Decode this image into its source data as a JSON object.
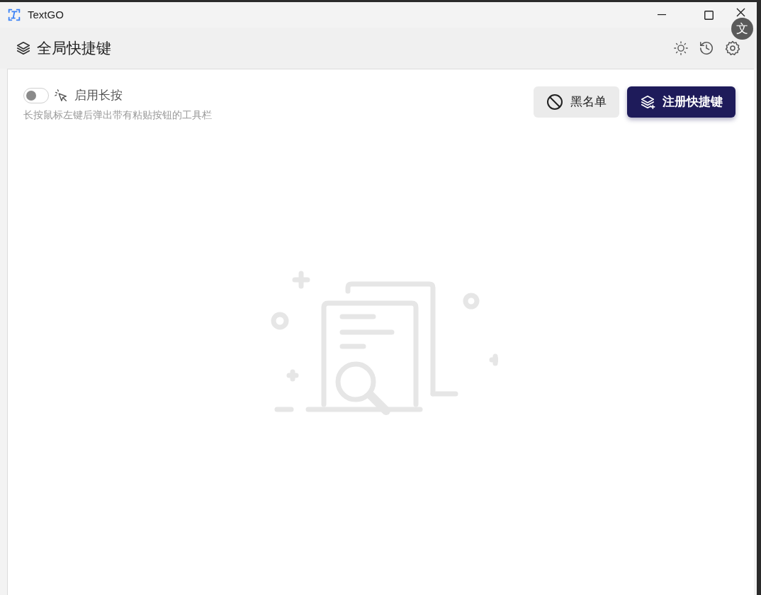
{
  "window": {
    "title": "TextGO"
  },
  "overlay": {
    "label": "文"
  },
  "header": {
    "title": "全局快捷键"
  },
  "long_press": {
    "label": "启用长按",
    "on": false,
    "description": "长按鼠标左键后弹出带有粘贴按钮的工具栏"
  },
  "buttons": [
    {
      "kind": "secondary",
      "label": "黑名单"
    },
    {
      "kind": "primary",
      "label": "注册快捷键"
    }
  ]
}
